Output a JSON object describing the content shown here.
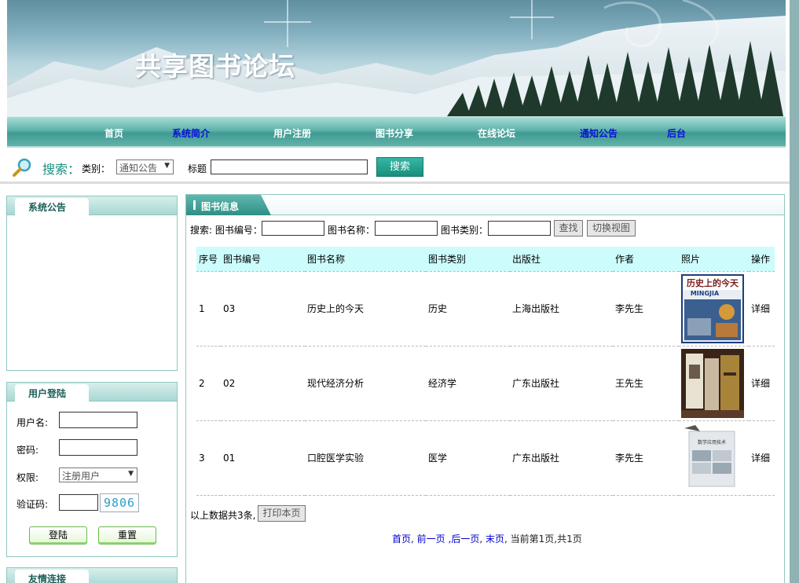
{
  "site": {
    "title": "共享图书论坛"
  },
  "nav": [
    {
      "label": "首页",
      "color": "#ffffff"
    },
    {
      "label": "系统简介",
      "color": "#0a12d8"
    },
    {
      "label": "用户注册",
      "color": "#ffffff"
    },
    {
      "label": "图书分享",
      "color": "#ffffff"
    },
    {
      "label": "在线论坛",
      "color": "#ffffff"
    },
    {
      "label": "通知公告",
      "color": "#0a12d8"
    },
    {
      "label": "后台",
      "color": "#0a12d8"
    }
  ],
  "topsearch": {
    "title": "搜索：",
    "category_label": "类别：",
    "category_value": "通知公告",
    "subject_label": "标题",
    "subject_value": "",
    "button": "搜索"
  },
  "announce": {
    "title": "系统公告"
  },
  "login": {
    "title": "用户登陆",
    "username_label": "用户名:",
    "password_label": "密码:",
    "role_label": "权限:",
    "role_value": "注册用户",
    "captcha_label": "验证码:",
    "captcha_code": "9806",
    "login_button": "登陆",
    "reset_button": "重置"
  },
  "links": {
    "title": "友情连接"
  },
  "books": {
    "title": "图书信息",
    "filter": {
      "search_label": "搜索: 图书编号：",
      "name_label": "图书名称：",
      "category_label": "图书类别：",
      "find_button": "查找",
      "switch_button": "切换视图"
    },
    "columns": [
      "序号",
      "图书编号",
      "图书名称",
      "图书类别",
      "出版社",
      "作者",
      "照片",
      "操作"
    ],
    "rows": [
      {
        "index": "1",
        "code": "03",
        "name": "历史上的今天",
        "category": "历史",
        "publisher": "上海出版社",
        "author": "李先生",
        "photo": "history-book-cover",
        "action": "详细"
      },
      {
        "index": "2",
        "code": "02",
        "name": "现代经济分析",
        "category": "经济学",
        "publisher": "广东出版社",
        "author": "王先生",
        "photo": "economics-books-photo",
        "action": "详细"
      },
      {
        "index": "3",
        "code": "01",
        "name": "口腔医学实验",
        "category": "医学",
        "publisher": "广东出版社",
        "author": "李先生",
        "photo": "medicine-book-cover",
        "action": "详细"
      }
    ],
    "total_text": "以上数据共3条,",
    "print_button": "打印本页",
    "pager": {
      "first": "首页",
      "prev": "前一页",
      "next": ",后一页",
      "last": "末页",
      "status": "当前第1页,共1页"
    }
  },
  "cover_titles": {
    "history": "历史上的今天",
    "history_sub": "MINGJIA",
    "medicine": "数学应用技术"
  }
}
